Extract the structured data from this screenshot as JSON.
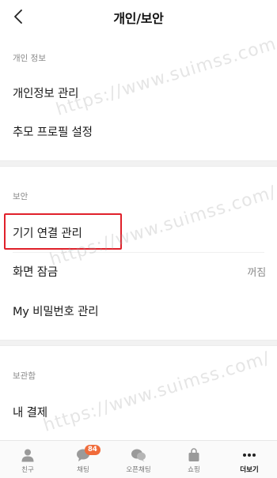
{
  "header": {
    "title": "개인/보안",
    "back_icon": "chevron-left-icon"
  },
  "sections": {
    "personal": {
      "label": "개인 정보",
      "items": [
        "개인정보 관리",
        "추모 프로필 설정"
      ]
    },
    "security": {
      "label": "보안",
      "items": [
        {
          "label": "기기 연결 관리",
          "highlighted": true
        },
        {
          "label": "화면 잠금",
          "value": "꺼짐"
        },
        {
          "label": "My 비밀번호 관리"
        }
      ]
    },
    "storage": {
      "label": "보관함",
      "items": [
        "내 결제"
      ]
    }
  },
  "watermark": "https://www.suimss.com/",
  "tabbar": {
    "tabs": [
      {
        "label": "친구",
        "icon": "person-icon"
      },
      {
        "label": "채팅",
        "icon": "chat-bubble-icon",
        "badge": "84"
      },
      {
        "label": "오픈채팅",
        "icon": "open-chat-icon"
      },
      {
        "label": "쇼핑",
        "icon": "shopping-bag-icon"
      },
      {
        "label": "더보기",
        "icon": "more-dots-icon",
        "active": true
      }
    ]
  },
  "colors": {
    "highlight": "#e0202a",
    "badge": "#f06b3a",
    "section_label": "#8a8a8a"
  }
}
